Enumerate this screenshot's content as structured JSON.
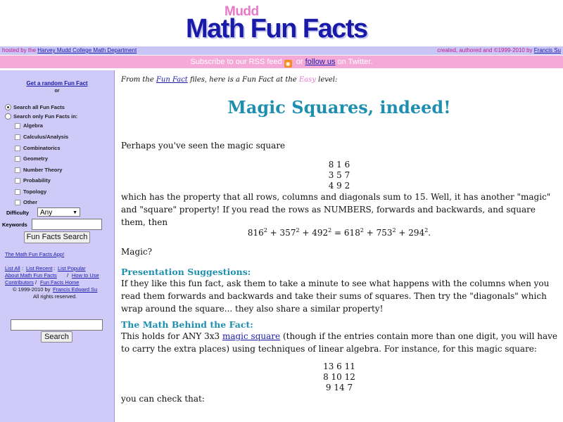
{
  "logo": {
    "small": "Mudd",
    "main": "Math Fun Facts"
  },
  "topbar": {
    "left_prefix": "hosted by the ",
    "left_link": "Harvey Mudd College Math Department",
    "right_prefix": "created, authored and ©1999-2010 by ",
    "right_link": "Francis Su"
  },
  "subscribe": {
    "prefix": "Subscribe to our RSS feed",
    "rss_icon": "rss-icon",
    "middle": " or ",
    "twitter_link": "follow us",
    "suffix": " on Twitter."
  },
  "sidebar": {
    "random_link": "Get a random Fun Fact",
    "or": "or",
    "search_all": "Search all Fun Facts",
    "search_only": "Search only Fun Facts in:",
    "categories": [
      "Algebra",
      "Calculus/Analysis",
      "Combinatorics",
      "Geometry",
      "Number Theory",
      "Probability",
      "Topology",
      "Other"
    ],
    "difficulty_label": "Difficulty",
    "difficulty_value": "Any",
    "keywords_label": "Keywords",
    "search_button": "Fun Facts Search",
    "app_link": "The Math Fun Facts App!",
    "links": {
      "list_all": "List All",
      "list_recent": "List Recent",
      "list_popular": "List Popular",
      "about": "About Math Fun Facts",
      "how_to_use": "How to Use",
      "contributors": "Contributors",
      "home": "Fun Facts Home"
    },
    "sep": " : ",
    "sep2": " / ",
    "copyright_prefix": "© 1999-2010 by ",
    "copyright_link": "Francis Edward Su",
    "rights": "All rights reserved.",
    "site_search_button": "Search"
  },
  "main": {
    "intro_prefix": "From the ",
    "intro_link": "Fun Fact",
    "intro_middle": " files, here is a Fun Fact at the ",
    "intro_level": "Easy",
    "intro_suffix": " level:",
    "title": "Magic Squares, indeed!",
    "p1": "Perhaps you've seen the magic square",
    "square1": [
      "8 1 6",
      "3 5 7",
      "4 9 2"
    ],
    "p2": "which has the property that all rows, columns and diagonals sum to 15. Well, it has another \"magic\" and \"square\" property! If you read the rows as NUMBERS, forwards and backwards, and square them, then",
    "eq1": {
      "a": "816",
      "b": "357",
      "c": "492",
      "d": "618",
      "e": "753",
      "f": "294",
      "exp": "2"
    },
    "magic": "Magic?",
    "h1": "Presentation Suggestions:",
    "p3": "If they like this fun fact, ask them to take a minute to see what happens with the columns when you read them forwards and backwards and take their sums of squares. Then try the \"diagonals\" which wrap around the square... they also share a similar property!",
    "h2": "The Math Behind the Fact:",
    "p4_prefix": "This holds for ANY 3x3 ",
    "p4_link": "magic square",
    "p4_suffix": " (though if the entries contain more than one digit, you will have to carry the extra places) using techniques of linear algebra. For instance, for this magic square:",
    "square2": [
      "13 6 11",
      "8 10 12",
      "9 14 7"
    ],
    "check": "you can check that:"
  }
}
